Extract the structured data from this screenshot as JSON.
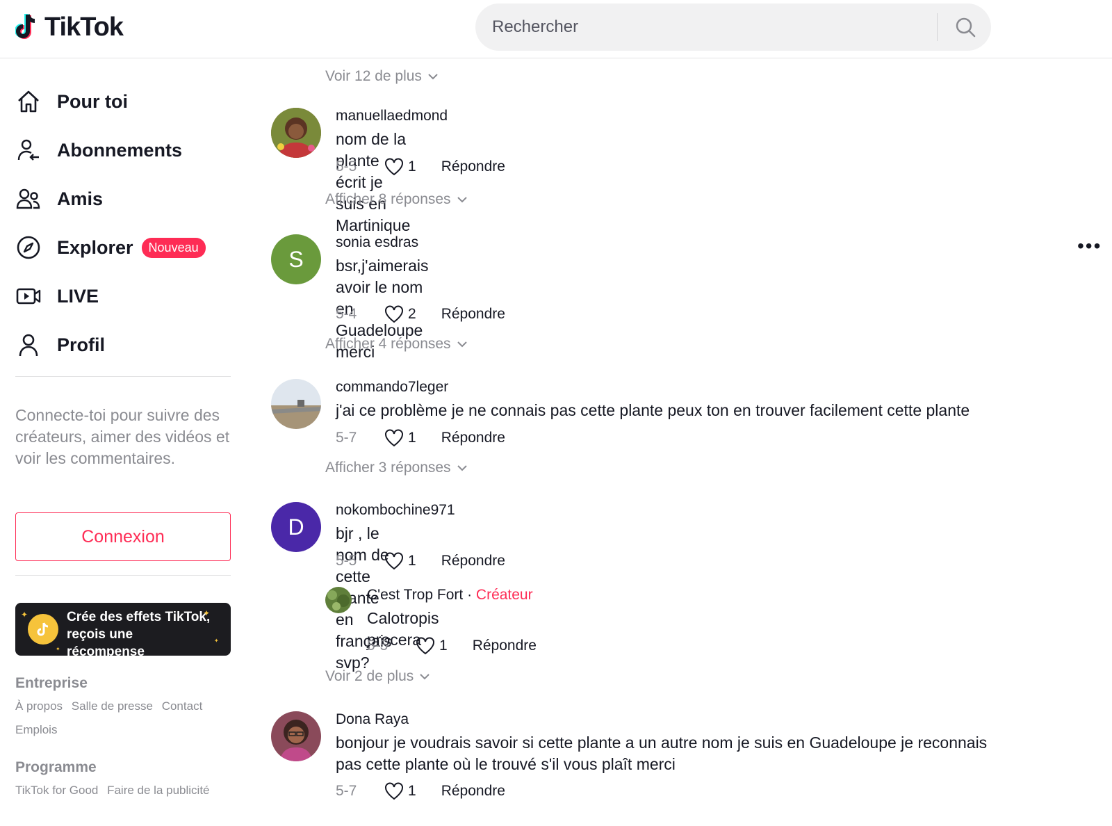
{
  "header": {
    "logo_text": "TikTok",
    "search_placeholder": "Rechercher"
  },
  "sidebar": {
    "nav": [
      {
        "label": "Pour toi",
        "icon": "home-icon"
      },
      {
        "label": "Abonnements",
        "icon": "following-icon"
      },
      {
        "label": "Amis",
        "icon": "friends-icon"
      },
      {
        "label": "Explorer",
        "icon": "compass-icon",
        "badge": "Nouveau"
      },
      {
        "label": "LIVE",
        "icon": "live-icon"
      },
      {
        "label": "Profil",
        "icon": "profile-icon"
      }
    ],
    "login_prompt": "Connecte-toi pour suivre des créateurs, aimer des vidéos et voir les commentaires.",
    "login_button": "Connexion",
    "effects_banner": "Crée des effets TikTok, reçois une récompense",
    "footer": {
      "company_title": "Entreprise",
      "company_links": [
        "À propos",
        "Salle de presse",
        "Contact",
        "Emplois"
      ],
      "program_title": "Programme",
      "program_links": [
        "TikTok for Good",
        "Faire de la publicité"
      ]
    }
  },
  "comments": {
    "see_more_top": "Voir 12 de plus",
    "items": [
      {
        "username": "manuellaedmond",
        "text": "nom de la plante écrit je suis en Martinique",
        "date": "5-5",
        "likes": "1",
        "reply": "Répondre",
        "replies_link": "Afficher 8 réponses"
      },
      {
        "username": "sonia esdras",
        "avatar_letter": "S",
        "text_line1": "bsr,j'aimerais avoir le nom en Guadeloupe",
        "text_line2": "merci",
        "date": "5-4",
        "likes": "2",
        "reply": "Répondre",
        "replies_link": "Afficher 4 réponses"
      },
      {
        "username": "commando7leger",
        "text": "j'ai ce problème je ne connais pas cette plante peux ton en trouver facilement cette plante",
        "date": "5-7",
        "likes": "1",
        "reply": "Répondre",
        "replies_link": "Afficher 3 réponses"
      },
      {
        "username": "nokombochine971",
        "avatar_letter": "D",
        "text": "bjr , le nom de cette plante en français svp?",
        "date": "5-5",
        "likes": "1",
        "reply": "Répondre",
        "sub_reply": {
          "username": "C'est Trop Fort",
          "separator": "·",
          "creator_label": "Créateur",
          "text": "Calotropis procera",
          "date": "5-5",
          "likes": "1",
          "reply": "Répondre"
        },
        "see_more": "Voir 2 de plus"
      },
      {
        "username": "Dona Raya",
        "text_line1": "bonjour je voudrais savoir si cette plante a un autre nom je suis en Guadeloupe je reconnais",
        "text_line2": "pas cette plante où le trouvé s'il vous plaît merci",
        "date": "5-7",
        "likes": "1",
        "reply": "Répondre"
      }
    ]
  },
  "colors": {
    "accent": "#fe2c55",
    "text_primary": "#161823",
    "text_secondary": "#8a8b91",
    "avatar_green": "#6a9a3c",
    "avatar_purple": "#4a28a8"
  }
}
